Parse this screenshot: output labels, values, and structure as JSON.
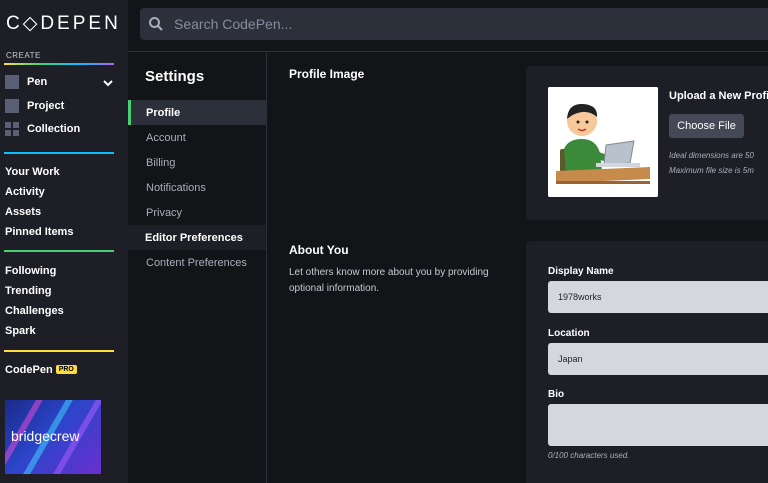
{
  "logo": "C◇DEPEN",
  "search": {
    "placeholder": "Search CodePen..."
  },
  "leftnav": {
    "create_label": "CREATE",
    "create_items": [
      {
        "label": "Pen",
        "icon": "pen-square-icon"
      },
      {
        "label": "Project",
        "icon": "project-square-icon"
      },
      {
        "label": "Collection",
        "icon": "collection-grid-icon"
      }
    ],
    "group1": [
      "Your Work",
      "Activity",
      "Assets",
      "Pinned Items"
    ],
    "group2": [
      "Following",
      "Trending",
      "Challenges",
      "Spark"
    ],
    "pro": {
      "label": "CodePen",
      "badge": "PRO"
    },
    "ad_text": "bridgecrew"
  },
  "settings": {
    "title": "Settings",
    "items": [
      "Profile",
      "Account",
      "Billing",
      "Notifications",
      "Privacy",
      "Editor Preferences",
      "Content Preferences"
    ],
    "active_index": 0
  },
  "profile_image": {
    "heading": "Profile Image",
    "upload_title": "Upload a New Profil",
    "button": "Choose File",
    "hint1": "Ideal dimensions are 50",
    "hint2": "Maximum file size is 5m"
  },
  "about": {
    "heading": "About You",
    "description": "Let others know more about you by providing optional information.",
    "display_name_label": "Display Name",
    "display_name_value": "1978works",
    "location_label": "Location",
    "location_value": "Japan",
    "bio_label": "Bio",
    "bio_value": "",
    "bio_counter": "0/100 characters used."
  },
  "colors": {
    "accent_green": "#47cf73",
    "accent_blue": "#0ebeff",
    "accent_yellow": "#ffdd40",
    "nav_bg": "#1e1f26",
    "page_bg": "#131417"
  }
}
